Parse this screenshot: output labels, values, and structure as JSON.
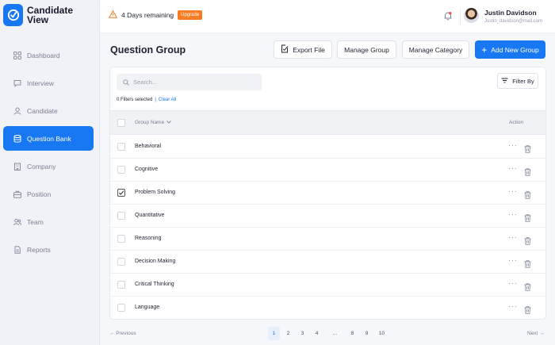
{
  "app": {
    "logo_text": "Candidate View"
  },
  "sidebar": {
    "items": [
      {
        "label": "Dashboard",
        "icon": "grid-icon"
      },
      {
        "label": "Interview",
        "icon": "chat-icon"
      },
      {
        "label": "Candidate",
        "icon": "user-icon"
      },
      {
        "label": "Question Bank",
        "icon": "database-icon",
        "active": true
      },
      {
        "label": "Company",
        "icon": "building-icon"
      },
      {
        "label": "Position",
        "icon": "briefcase-icon"
      },
      {
        "label": "Team",
        "icon": "users-icon"
      },
      {
        "label": "Reports",
        "icon": "document-icon"
      }
    ]
  },
  "topbar": {
    "trial_text": "4 Days remaining",
    "upgrade_label": "Upgrade",
    "user_name": "Justin Davidson",
    "user_email": "Justin_davidson@mail.com"
  },
  "header": {
    "title": "Question Group",
    "export_label": "Export File",
    "manage_group_label": "Manage Group",
    "manage_category_label": "Manage Category",
    "add_label": "Add New Group"
  },
  "toolbar": {
    "search_placeholder": "Search...",
    "filter_label": "Filter By",
    "filters_selected": "0 Filters selected",
    "separator": "|",
    "clear_all": "Clear All"
  },
  "table": {
    "col_name": "Group Name",
    "col_action": "Action",
    "rows": [
      {
        "name": "Behavioral",
        "checked": false
      },
      {
        "name": "Cognitive",
        "checked": false
      },
      {
        "name": "Problem Solving",
        "checked": true
      },
      {
        "name": "Quantitative",
        "checked": false
      },
      {
        "name": "Reasoning",
        "checked": false
      },
      {
        "name": "Decision Making",
        "checked": false
      },
      {
        "name": "Critical Thinking",
        "checked": false
      },
      {
        "name": "Language",
        "checked": false
      }
    ],
    "more_glyph": "···"
  },
  "pagination": {
    "prev_label": "← Previous",
    "next_label": "Next →",
    "pages": [
      "1",
      "2",
      "3",
      "4",
      "...",
      "8",
      "9",
      "10"
    ],
    "current": "1"
  },
  "colors": {
    "accent": "#1877f2",
    "upgrade": "#f57c23",
    "warning": "#f57c23"
  }
}
